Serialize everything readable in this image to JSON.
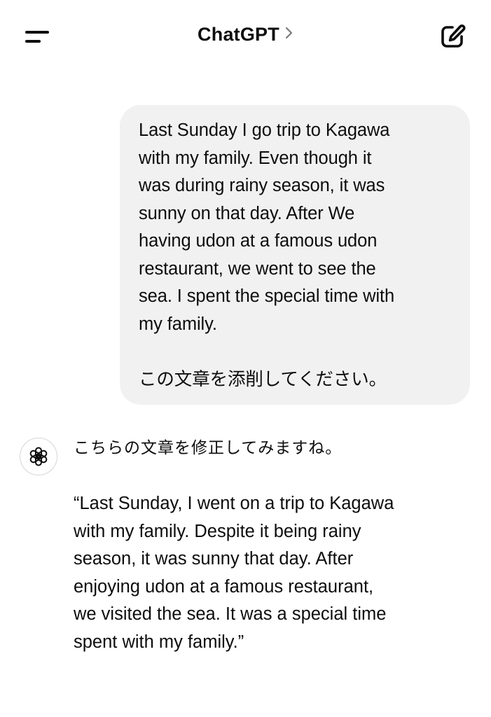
{
  "header": {
    "title": "ChatGPT",
    "menu_icon": "menu-icon",
    "chevron_icon": "chevron-right-icon",
    "compose_icon": "new-chat-icon"
  },
  "user_message": {
    "text": "Last Sunday I go trip to Kagawa\nwith my family. Even though it\nwas during rainy season, it was\nsunny on that day. After We\nhaving udon at a famous udon\nrestaurant, we went to see the\nsea. I spent the special time with\nmy family.\n\nこの文章を添削してください。"
  },
  "assistant_message": {
    "avatar_icon": "openai-logo-icon",
    "lead": "こちらの文章を修正してみますね。",
    "body": "“Last Sunday, I went on a trip to Kagawa\nwith my family. Despite it being rainy\nseason, it was sunny that day. After\nenjoying udon at a famous restaurant,\nwe visited the sea. It was a special time\nspent with my family.”"
  },
  "colors": {
    "background": "#ffffff",
    "bubble": "#f1f1f1",
    "text": "#0d0d0d",
    "muted": "#8e8e8e"
  }
}
